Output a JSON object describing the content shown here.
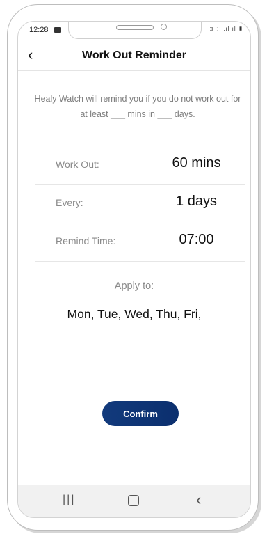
{
  "status_bar": {
    "time": "12:28",
    "system_icons": "⧖ ⸬ .ıl ıl ▮"
  },
  "header": {
    "back_icon": "‹",
    "title": "Work Out Reminder"
  },
  "description": "Healy Watch will remind you if you do not work out for at least ___ mins in ___ days.",
  "settings": [
    {
      "label": "Work Out:",
      "value": "60 mins"
    },
    {
      "label": "Every:",
      "value": "1 days"
    },
    {
      "label": "Remind Time:",
      "value": "07:00"
    }
  ],
  "apply": {
    "label": "Apply to:",
    "days": "Mon, Tue, Wed, Thu, Fri,"
  },
  "confirm_label": "Confirm",
  "nav": {
    "recent": "|||",
    "back": "‹"
  },
  "colors": {
    "confirm_bg": "#123a7c",
    "text_primary": "#111111",
    "text_secondary": "#8a8a8a"
  }
}
